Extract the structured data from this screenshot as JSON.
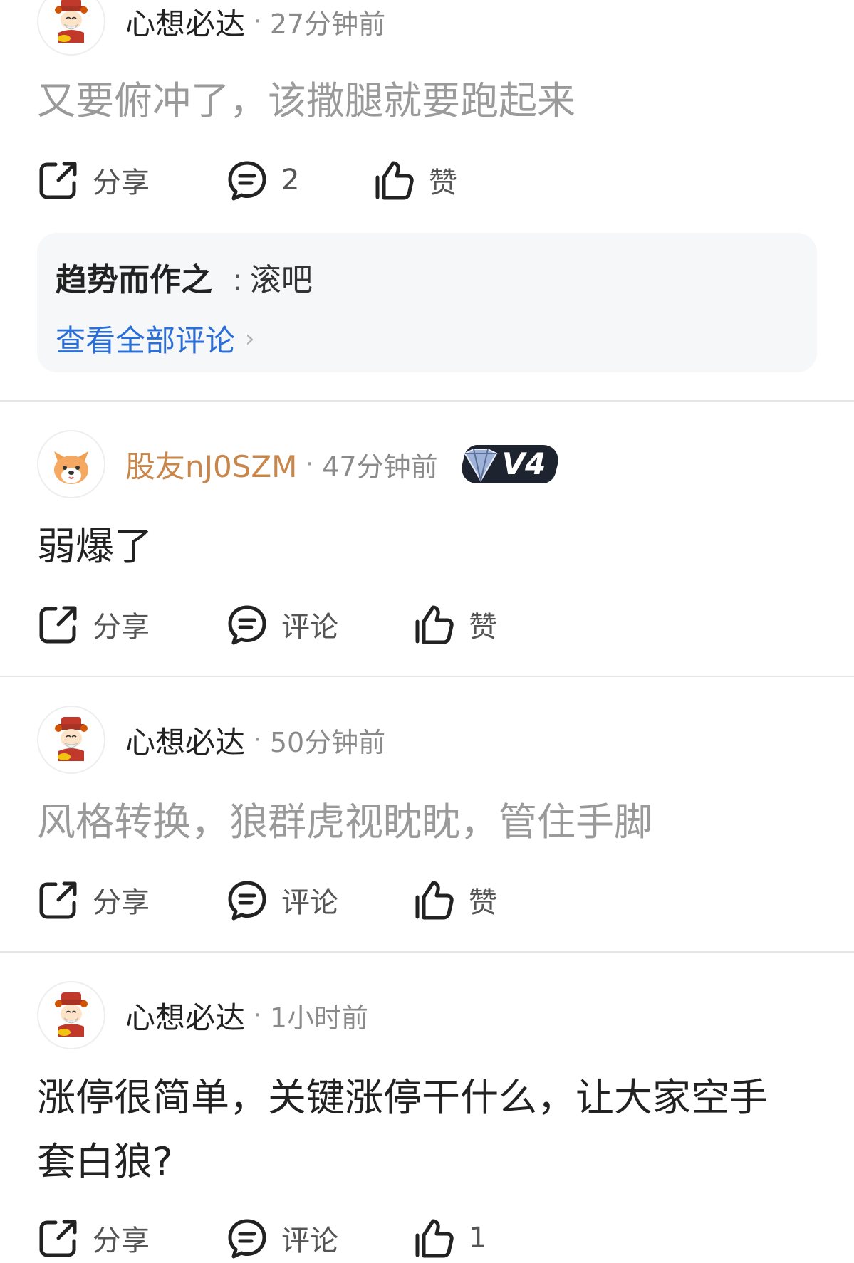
{
  "posts": [
    {
      "username": "心想必达",
      "time": "27分钟前",
      "text": "又要俯冲了，该撒腿就要跑起来",
      "share_label": "分享",
      "comment_label": "2",
      "like_label": "赞",
      "reply": {
        "user": "趋势而作之",
        "separator": ":",
        "text": "滚吧",
        "view_all": "查看全部评论",
        "chevron": "›"
      }
    },
    {
      "username": "股友nJ0SZM",
      "time": "47分钟前",
      "badge": "V4",
      "text": "弱爆了",
      "share_label": "分享",
      "comment_label": "评论",
      "like_label": "赞"
    },
    {
      "username": "心想必达",
      "time": "50分钟前",
      "text": "风格转换，狼群虎视眈眈，管住手脚",
      "share_label": "分享",
      "comment_label": "评论",
      "like_label": "赞"
    },
    {
      "username": "心想必达",
      "time": "1小时前",
      "text_line1": "涨停很简单，关键涨停干什么，让大家空手",
      "text_line2": "套白狼?",
      "share_label": "分享",
      "comment_label": "评论",
      "like_label": "1"
    }
  ],
  "separator_dot": "·",
  "colors": {
    "accent_link": "#2a6fd8",
    "username_orange": "#c8864a",
    "muted_text": "#9a9a9a"
  }
}
